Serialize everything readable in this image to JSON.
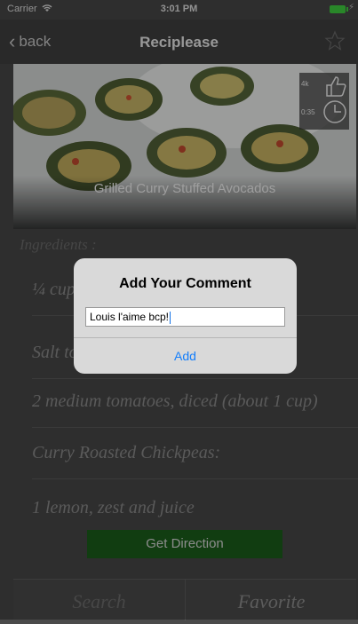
{
  "status_bar": {
    "carrier": "Carrier",
    "time": "3:01 PM"
  },
  "nav": {
    "back_label": "back",
    "title": "Reciplease"
  },
  "recipe": {
    "title": "Grilled Curry Stuffed Avocados",
    "likes": "4k",
    "duration": "0:35"
  },
  "ingredients": {
    "header": "Ingredients :",
    "items": [
      "¼ cup",
      "Salt to",
      "2 medium tomatoes, diced (about 1 cup)",
      "Curry Roasted Chickpeas:",
      "1 lemon, zest and juice"
    ]
  },
  "direction_button": "Get Direction",
  "tabs": {
    "search": "Search",
    "favorite": "Favorite"
  },
  "alert": {
    "title": "Add Your Comment",
    "comment_value": "Louis l'aime bcp!",
    "add_label": "Add"
  },
  "colors": {
    "accent": "#147efb",
    "direction_button": "#1b5f1b",
    "battery": "#3fcf3f"
  }
}
